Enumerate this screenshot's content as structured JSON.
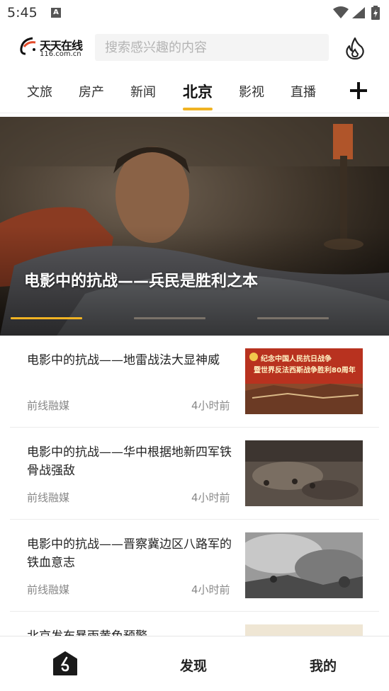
{
  "status_bar": {
    "time": "5:45",
    "notification_icon": "A",
    "icons": [
      "wifi-icon",
      "signal-icon",
      "battery-charging-icon"
    ]
  },
  "header": {
    "logo_name": "天天在线",
    "logo_domain": "116.com.cn",
    "search_placeholder": "搜索感兴趣的内容",
    "hot_icon": "flame-icon"
  },
  "tabs": {
    "items": [
      {
        "label": "文旅",
        "active": false
      },
      {
        "label": "房产",
        "active": false
      },
      {
        "label": "新闻",
        "active": false
      },
      {
        "label": "北京",
        "active": true
      },
      {
        "label": "影视",
        "active": false
      },
      {
        "label": "直播",
        "active": false
      }
    ],
    "add_icon": "plus-icon",
    "accent_color": "#f0b323"
  },
  "hero": {
    "title": "电影中的抗战——兵民是胜利之本",
    "slide_count": 3,
    "active_slide": 1
  },
  "news": [
    {
      "title": "电影中的抗战——地雷战法大显神威",
      "source": "前线融媒",
      "time": "4小时前",
      "thumb_caption_line1": "纪念中国人民抗日战争",
      "thumb_caption_line2": "暨世界反法西斯战争胜利80周年"
    },
    {
      "title": "电影中的抗战——华中根据地新四军铁骨战强敌",
      "source": "前线融媒",
      "time": "4小时前"
    },
    {
      "title": "电影中的抗战——晋察冀边区八路军的铁血意志",
      "source": "前线融媒",
      "time": "4小时前"
    },
    {
      "title": "北京发布暴雨黄色预警",
      "source": "",
      "time": ""
    }
  ],
  "bottom_nav": {
    "home_icon": "home-logo-icon",
    "discover_label": "发现",
    "mine_label": "我的"
  }
}
